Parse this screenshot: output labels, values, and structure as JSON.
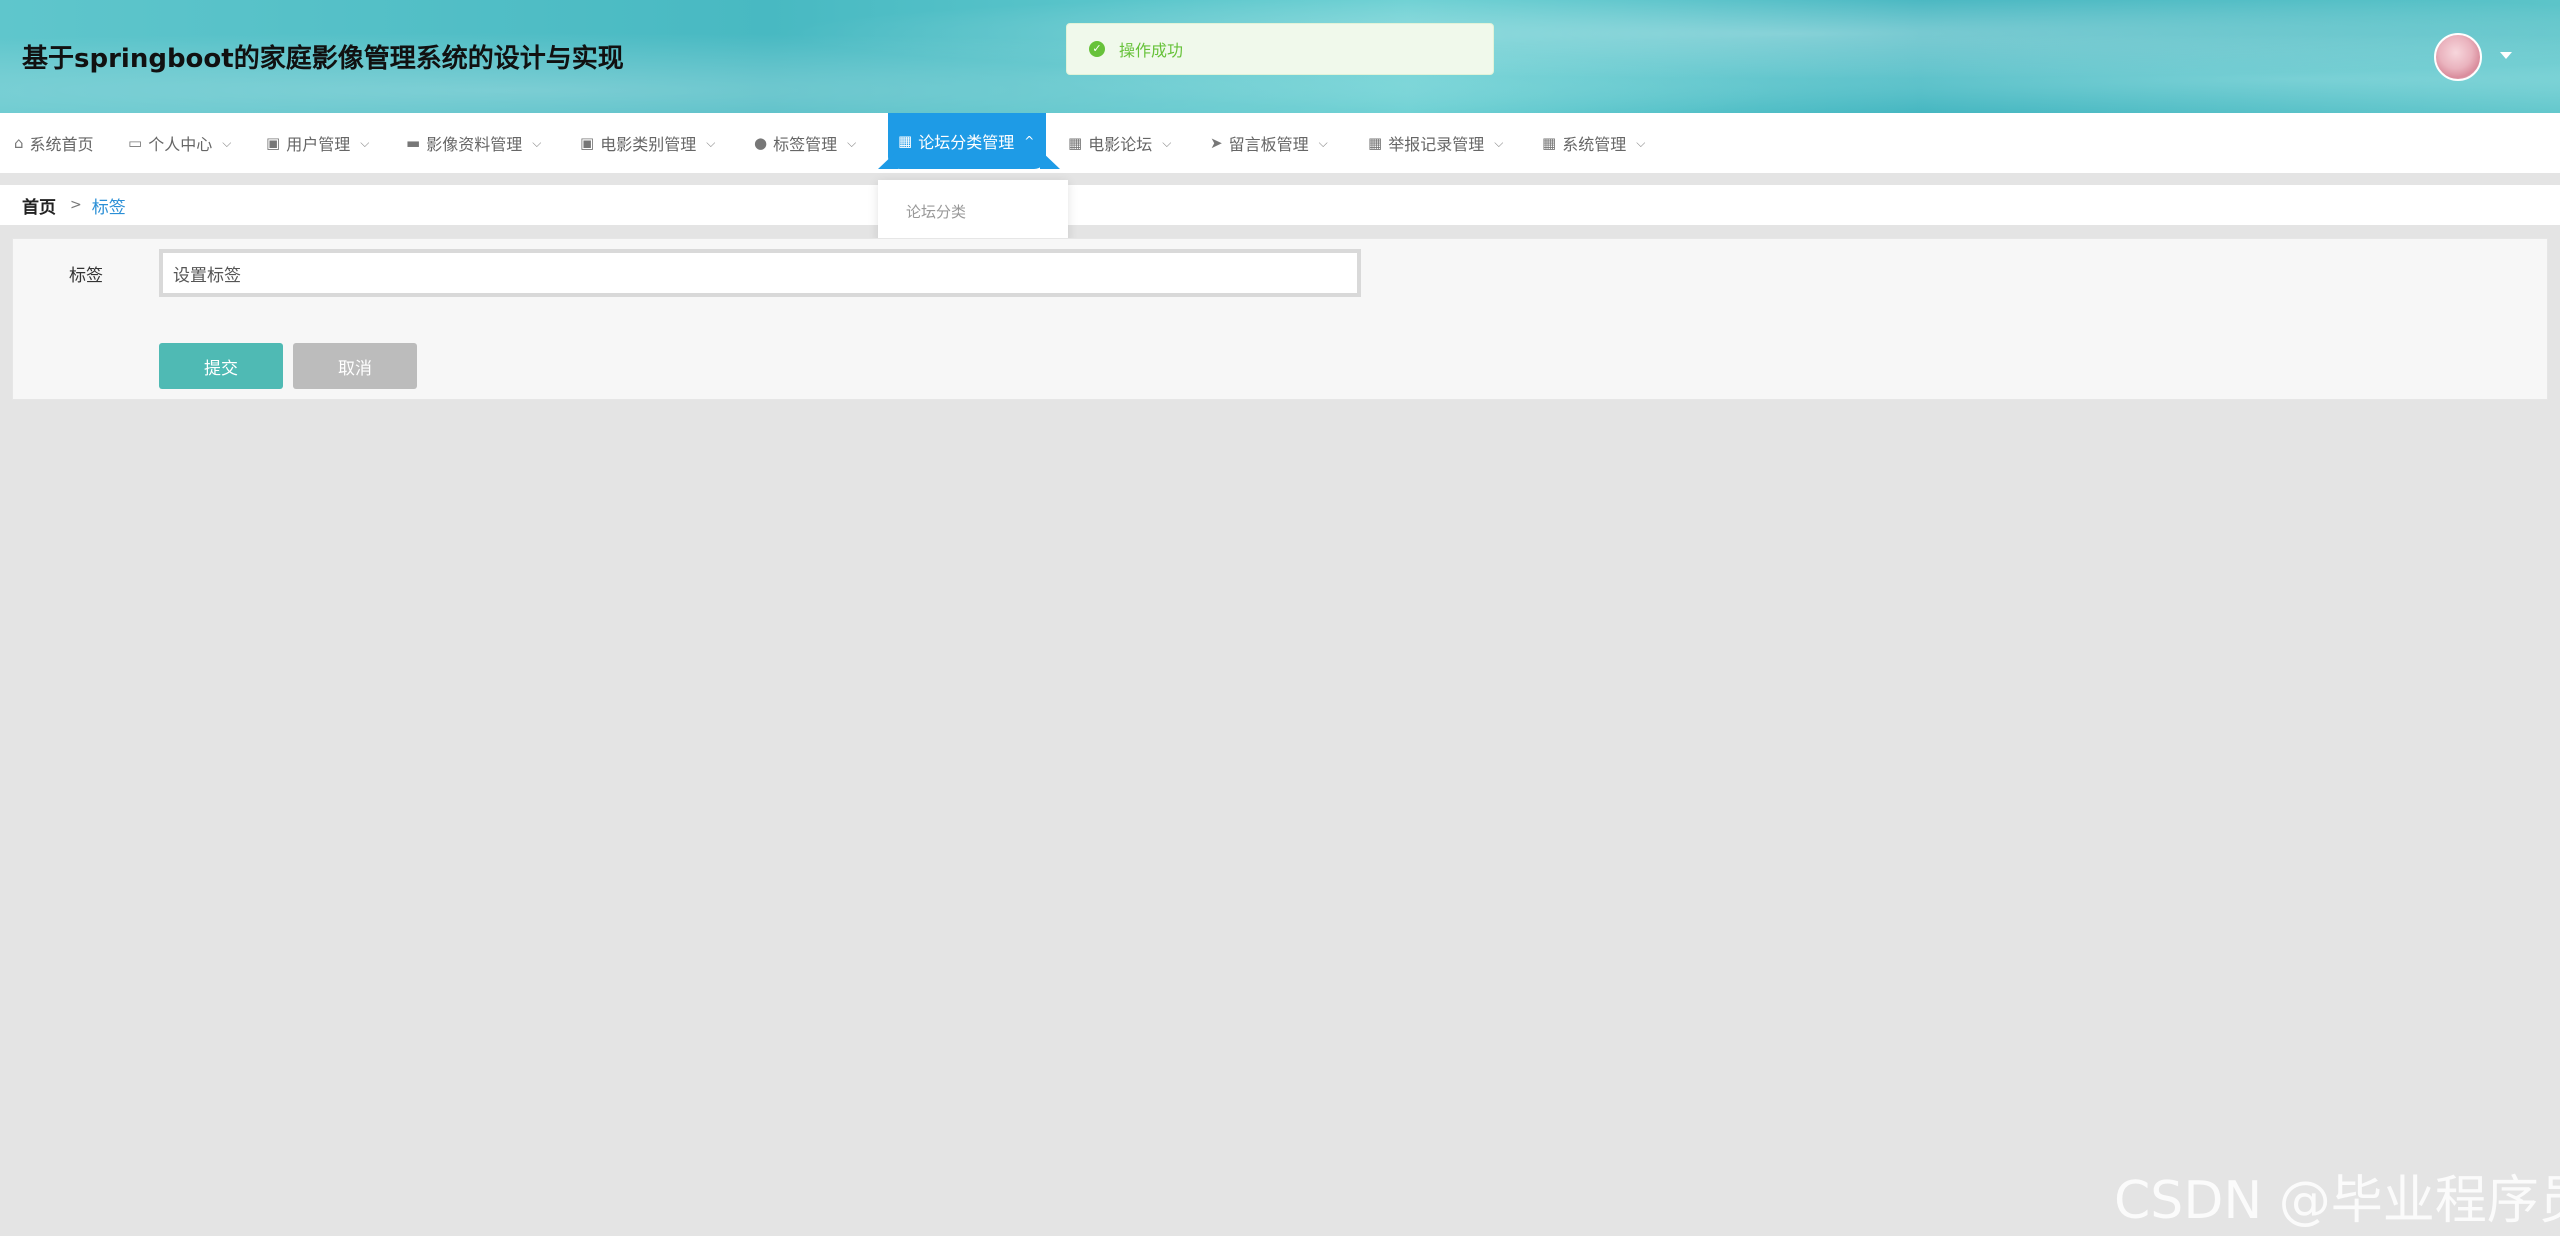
{
  "header": {
    "title": "基于springboot的家庭影像管理系统的设计与实现",
    "toast": "操作成功"
  },
  "nav": {
    "items": [
      {
        "label": "系统首页",
        "icon": "home-icon",
        "glyph": "⌂"
      },
      {
        "label": "个人中心",
        "icon": "window-icon",
        "glyph": "▭"
      },
      {
        "label": "用户管理",
        "icon": "clipboard-icon",
        "glyph": "▣"
      },
      {
        "label": "影像资料管理",
        "icon": "briefcase-icon",
        "glyph": "▬"
      },
      {
        "label": "电影类别管理",
        "icon": "clipboard-check-icon",
        "glyph": "▣"
      },
      {
        "label": "标签管理",
        "icon": "user-icon",
        "glyph": "●"
      },
      {
        "label": "论坛分类管理",
        "icon": "grid-icon",
        "glyph": "▦"
      },
      {
        "label": "电影论坛",
        "icon": "grid-icon",
        "glyph": "▦"
      },
      {
        "label": "留言板管理",
        "icon": "send-icon",
        "glyph": "➤"
      },
      {
        "label": "举报记录管理",
        "icon": "grid-icon",
        "glyph": "▦"
      },
      {
        "label": "系统管理",
        "icon": "grid-icon",
        "glyph": "▦"
      }
    ],
    "dropdown_item": "论坛分类"
  },
  "breadcrumb": {
    "home": "首页",
    "separator": ">",
    "current": "标签"
  },
  "form": {
    "label": "标签",
    "input_value": "设置标签",
    "submit_label": "提交",
    "cancel_label": "取消"
  },
  "watermark": "CSDN @毕业程序员",
  "colors": {
    "active_nav": "#1e9be6",
    "submit": "#4fbab4",
    "cancel": "#bcbcbc",
    "toast_text": "#67c23a"
  }
}
